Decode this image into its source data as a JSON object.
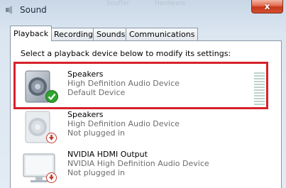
{
  "window": {
    "title": "Sound",
    "close_glyph": "x"
  },
  "background_fragments": [
    "Souffer",
    "Hardware"
  ],
  "tabs": [
    {
      "label": "Playback",
      "active": true
    },
    {
      "label": "Recording",
      "active": false
    },
    {
      "label": "Sounds",
      "active": false
    },
    {
      "label": "Communications",
      "active": false
    }
  ],
  "instruction": "Select a playback device below to modify its settings:",
  "devices": [
    {
      "name": "Speakers",
      "driver": "High Definition Audio Device",
      "status": "Default Device",
      "icon": "speaker-icon",
      "badge": "green-check-badge",
      "selected": true
    },
    {
      "name": "Speakers",
      "driver": "High Definition Audio Device",
      "status": "Not plugged in",
      "icon": "speaker-icon",
      "badge": "red-down-arrow-badge",
      "selected": false
    },
    {
      "name": "NVIDIA HDMI Output",
      "driver": "NVIDIA High Definition Audio Device",
      "status": "Not plugged in",
      "icon": "monitor-icon",
      "badge": "red-down-arrow-badge",
      "selected": false
    }
  ],
  "colors": {
    "highlight": "#d7222b",
    "check": "#2fa52f",
    "unplugged": "#c0392b"
  }
}
